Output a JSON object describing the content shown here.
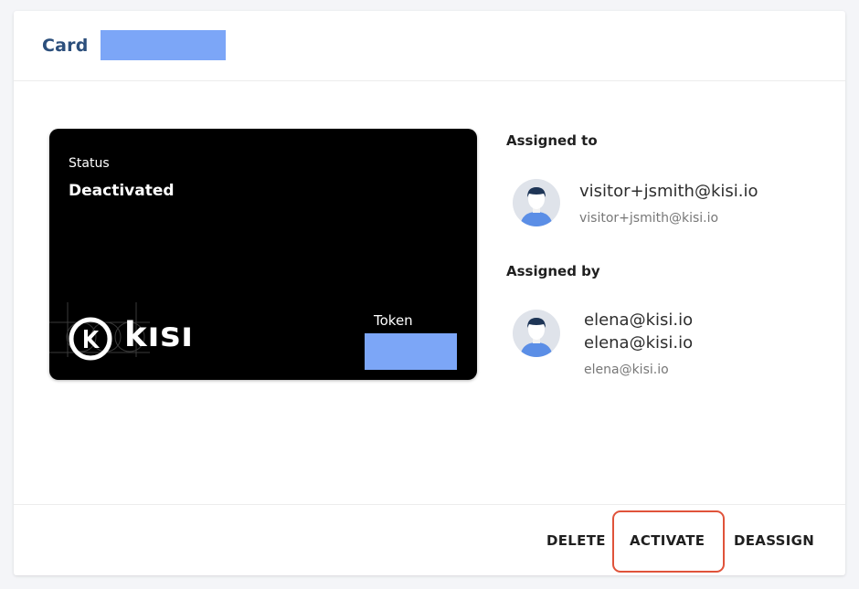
{
  "header": {
    "title": "Card"
  },
  "card": {
    "status_label": "Status",
    "status_value": "Deactivated",
    "brand": "kısı",
    "token_label": "Token"
  },
  "assigned_to": {
    "heading": "Assigned to",
    "name": "visitor+jsmith@kisi.io",
    "email": "visitor+jsmith@kisi.io"
  },
  "assigned_by": {
    "heading": "Assigned by",
    "name_line1": "elena@kisi.io",
    "name_line2": "elena@kisi.io",
    "email": "elena@kisi.io"
  },
  "actions": {
    "delete": "DELETE",
    "activate": "ACTIVATE",
    "deassign": "DEASSIGN"
  },
  "colors": {
    "title": "#2c4f7c",
    "redaction": "#7ca6f7",
    "highlight": "#e0533a",
    "card_bg": "#000000"
  }
}
